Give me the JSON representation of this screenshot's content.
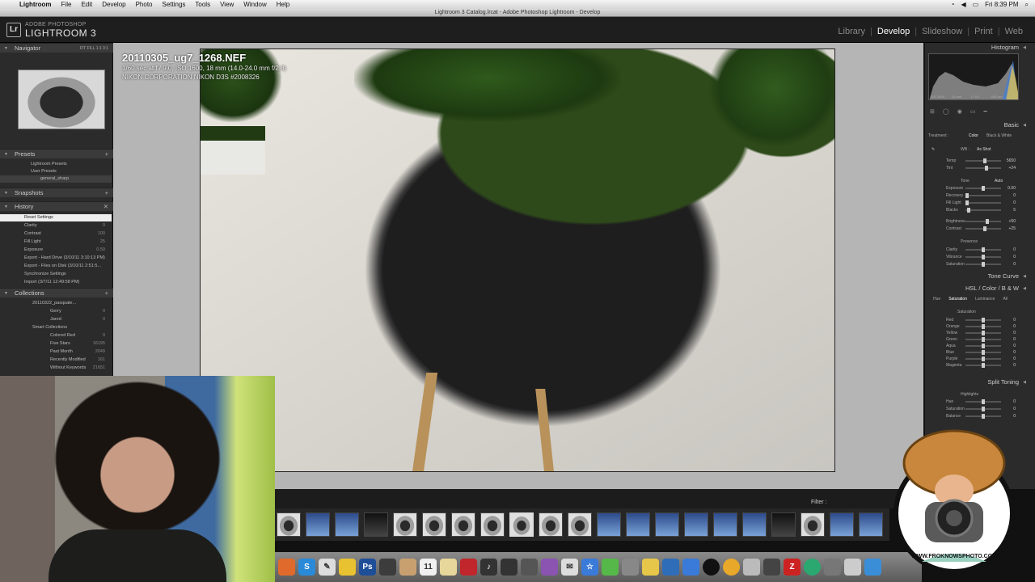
{
  "menubar": {
    "app": "Lightroom",
    "items": [
      "File",
      "Edit",
      "Develop",
      "Photo",
      "Settings",
      "Tools",
      "View",
      "Window",
      "Help"
    ],
    "clock": "Fri 8:39 PM"
  },
  "window_title": "Lightroom 3 Catalog.lrcat - Adobe Photoshop Lightroom - Develop",
  "brand": {
    "badge": "Lr",
    "small": "ADOBE PHOTOSHOP",
    "big": "LIGHTROOM 3"
  },
  "modules": {
    "items": [
      "Library",
      "Develop",
      "Slideshow",
      "Print",
      "Web"
    ],
    "active": "Develop"
  },
  "left_panel": {
    "navigator": "Navigator",
    "nav_zoom": "FIT  FILL  1:1  3:1",
    "presets": "Presets",
    "preset_items": [
      "Lightroom Presets",
      "User Presets",
      "general_sharp"
    ],
    "snapshots": "Snapshots",
    "history": "History",
    "history_items": [
      {
        "label": "Reset Settings",
        "value": ""
      },
      {
        "label": "Clarity",
        "value": "0"
      },
      {
        "label": "Contrast",
        "value": "100"
      },
      {
        "label": "Fill Light",
        "value": "25"
      },
      {
        "label": "Exposure",
        "value": "0.59"
      },
      {
        "label": "Export - Hard Drive (3/10/11 3:10:13 PM)",
        "value": ""
      },
      {
        "label": "Export - Files on Disk (3/10/11 2:51:5...",
        "value": ""
      },
      {
        "label": "Synchronize Settings",
        "value": ""
      },
      {
        "label": "Import (3/7/11 12:49:58 PM)",
        "value": ""
      }
    ],
    "collections": "Collections",
    "collection_items": [
      {
        "label": "20110322_pasquale...",
        "value": ""
      },
      {
        "label": "Gerry",
        "value": "0"
      },
      {
        "label": "Jared",
        "value": "0"
      },
      {
        "label": "Smart Collections",
        "value": ""
      },
      {
        "label": "Colored Red",
        "value": "0"
      },
      {
        "label": "Five Stars",
        "value": "16195"
      },
      {
        "label": "Past Month",
        "value": "2049"
      },
      {
        "label": "Recently Modified",
        "value": "161"
      },
      {
        "label": "Without Keywords",
        "value": "21651"
      }
    ]
  },
  "photo_info": {
    "filename": "20110305_ug7_1268.NEF",
    "exif": "1/60 sec at f / 9.0, ISO 1600, 18 mm (14.0-24.0 mm f/2.8)",
    "camera": "NIKON CORPORATION NIKON D3S #2008326"
  },
  "right_panel": {
    "histogram": "Histogram",
    "hist_info": [
      "ISO 1600",
      "18 mm",
      "f / 9.0",
      "1/60 sec"
    ],
    "basic": "Basic",
    "treatment_label": "Treatment :",
    "treatment_options": [
      "Color",
      "Black & White"
    ],
    "wb_label": "WB :",
    "wb_value": "As Shot",
    "sliders": [
      {
        "label": "Temp",
        "value": "5650",
        "pos": 0.55
      },
      {
        "label": "Tint",
        "value": "+24",
        "pos": 0.6
      },
      {
        "label": "Exposure",
        "value": "0.00",
        "pos": 0.5
      },
      {
        "label": "Recovery",
        "value": "0",
        "pos": 0.0
      },
      {
        "label": "Fill Light",
        "value": "0",
        "pos": 0.0
      },
      {
        "label": "Blacks",
        "value": "5",
        "pos": 0.06
      },
      {
        "label": "Brightness",
        "value": "+50",
        "pos": 0.62
      },
      {
        "label": "Contrast",
        "value": "+25",
        "pos": 0.56
      },
      {
        "label": "Clarity",
        "value": "0",
        "pos": 0.5
      },
      {
        "label": "Vibrance",
        "value": "0",
        "pos": 0.5
      },
      {
        "label": "Saturation",
        "value": "0",
        "pos": 0.5
      }
    ],
    "tone_label": "Tone",
    "auto_label": "Auto",
    "presence_label": "Presence",
    "tone_curve": "Tone Curve",
    "hsl": "HSL / Color / B & W",
    "hsl_tabs": [
      "Hue",
      "Saturation",
      "Luminance",
      "All"
    ],
    "hsl_section": "Saturation",
    "hsl_sliders": [
      {
        "label": "Red",
        "value": "0"
      },
      {
        "label": "Orange",
        "value": "0"
      },
      {
        "label": "Yellow",
        "value": "0"
      },
      {
        "label": "Green",
        "value": "0"
      },
      {
        "label": "Aqua",
        "value": "0"
      },
      {
        "label": "Blue",
        "value": "0"
      },
      {
        "label": "Purple",
        "value": "0"
      },
      {
        "label": "Magenta",
        "value": "0"
      }
    ],
    "split_toning": "Split Toning",
    "split_highlights": "Highlights",
    "split_sliders": [
      {
        "label": "Hue",
        "value": "0"
      },
      {
        "label": "Saturation",
        "value": "0"
      },
      {
        "label": "Balance",
        "value": "0"
      }
    ]
  },
  "filmstrip": {
    "filter_label": "Filter :",
    "thumbs": [
      "crowd",
      "blue",
      "blue",
      "dark",
      "crowd",
      "crowd",
      "crowd",
      "crowd",
      "crowd",
      "crowd",
      "crowd",
      "blue",
      "blue",
      "blue",
      "blue",
      "blue",
      "blue",
      "dark",
      "crowd",
      "blue",
      "blue"
    ],
    "selected_index": 8
  },
  "watermark": "WWW.FROKNOWSPHOTO.COM",
  "colors": {
    "panel": "#2b2b2b",
    "accent": "#ffffff",
    "background": "#b5b5b5"
  }
}
